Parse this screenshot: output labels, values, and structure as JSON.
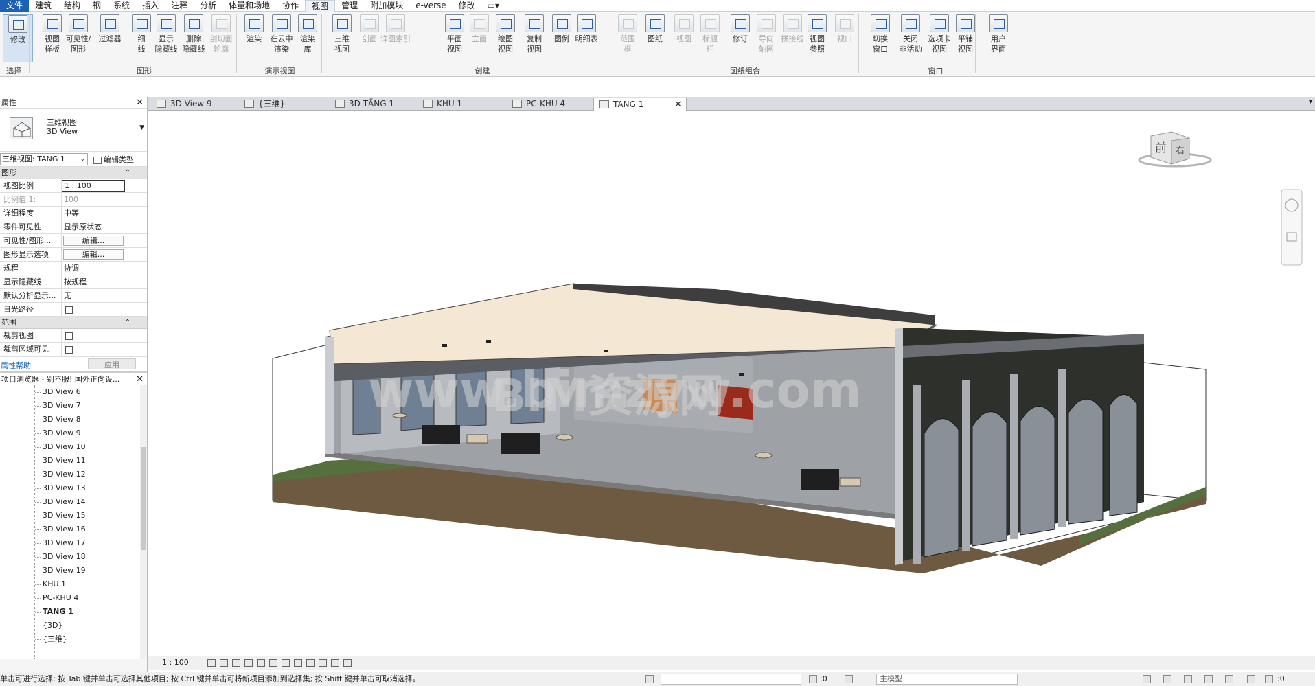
{
  "menu": [
    "文件",
    "建筑",
    "结构",
    "钢",
    "系统",
    "插入",
    "注释",
    "分析",
    "体量和场地",
    "协作",
    "视图",
    "管理",
    "附加模块",
    "e-verse",
    "修改"
  ],
  "ribbon": {
    "buttons": [
      {
        "label": "修改"
      },
      {
        "label": "视图\n样板"
      },
      {
        "label": "可见性/\n图形"
      },
      {
        "label": "过滤器"
      },
      {
        "label": "细\n线"
      },
      {
        "label": "显示\n隐藏线"
      },
      {
        "label": "删除\n隐藏线"
      },
      {
        "label": "剖切面\n轮廓"
      },
      {
        "label": "渲染"
      },
      {
        "label": "在云中\n渲染"
      },
      {
        "label": "渲染\n库"
      },
      {
        "label": "三维\n视图"
      },
      {
        "label": "剖面"
      },
      {
        "label": "详图索引"
      },
      {
        "label": "平面\n视图"
      },
      {
        "label": "立面"
      },
      {
        "label": "绘图\n视图"
      },
      {
        "label": "复制\n视图"
      },
      {
        "label": "图例"
      },
      {
        "label": "明细表"
      },
      {
        "label": "范围\n框"
      },
      {
        "label": "图纸"
      },
      {
        "label": "视图"
      },
      {
        "label": "标题\n栏"
      },
      {
        "label": "修订"
      },
      {
        "label": "导向\n轴网"
      },
      {
        "label": "拼接线"
      },
      {
        "label": "视图\n参照"
      },
      {
        "label": "视口"
      },
      {
        "label": "切换\n窗口"
      },
      {
        "label": "关闭\n非活动"
      },
      {
        "label": "选项卡\n视图"
      },
      {
        "label": "平铺\n视图"
      },
      {
        "label": "用户\n界面"
      }
    ],
    "groups": [
      "选择",
      "图形",
      "演示视图",
      "创建",
      "图纸组合",
      "窗口"
    ]
  },
  "properties": {
    "title": "属性",
    "type_name": "三维视图",
    "type_sub": "3D View",
    "view_selector": "三维视图: TANG 1",
    "edit_type": "编辑类型",
    "sections": [
      "图形",
      "范围"
    ],
    "rows": [
      {
        "k": "视图比例",
        "v": "1 : 100"
      },
      {
        "k": "比例值 1:",
        "v": "100"
      },
      {
        "k": "详细程度",
        "v": "中等"
      },
      {
        "k": "零件可见性",
        "v": "显示原状态"
      },
      {
        "k": "可见性/图形...",
        "v": "编辑..."
      },
      {
        "k": "图形显示选项",
        "v": "编辑..."
      },
      {
        "k": "规程",
        "v": "协调"
      },
      {
        "k": "显示隐藏线",
        "v": "按规程"
      },
      {
        "k": "默认分析显示...",
        "v": "无"
      },
      {
        "k": "日光路径",
        "v": ""
      },
      {
        "k": "裁剪视图",
        "v": ""
      },
      {
        "k": "裁剪区域可见",
        "v": ""
      }
    ],
    "help": "属性帮助",
    "apply": "应用"
  },
  "browser": {
    "title": "项目浏览器 - 别不服! 国外正向设...",
    "items": [
      "3D View 6",
      "3D View 7",
      "3D View 8",
      "3D View 9",
      "3D View 10",
      "3D View 11",
      "3D View 12",
      "3D View 13",
      "3D View 14",
      "3D View 15",
      "3D View 16",
      "3D View 17",
      "3D View 18",
      "3D View 19",
      "KHU 1",
      "PC-KHU 4",
      "TANG 1",
      "{3D}",
      "{三维}"
    ],
    "active": "TANG 1"
  },
  "tabs": [
    "3D View 9",
    "{三维}",
    "3D TẦNG 1",
    "KHU 1",
    "PC-KHU 4",
    "TANG 1"
  ],
  "active_tab": "TANG 1",
  "viewcube": {
    "front": "前",
    "right": "右"
  },
  "watermark": {
    "line1": "BIM资源网",
    "line2": "www.bimzyw.com"
  },
  "viewbar": {
    "scale": "1 : 100"
  },
  "status": {
    "message": "单击可进行选择; 按 Tab 键并单击可选择其他项目; 按 Ctrl 键并单击可将新项目添加到选择集; 按 Shift 键并单击可取消选择。",
    "zero1": ":0",
    "model": "主模型",
    "filter_count": ":0"
  }
}
